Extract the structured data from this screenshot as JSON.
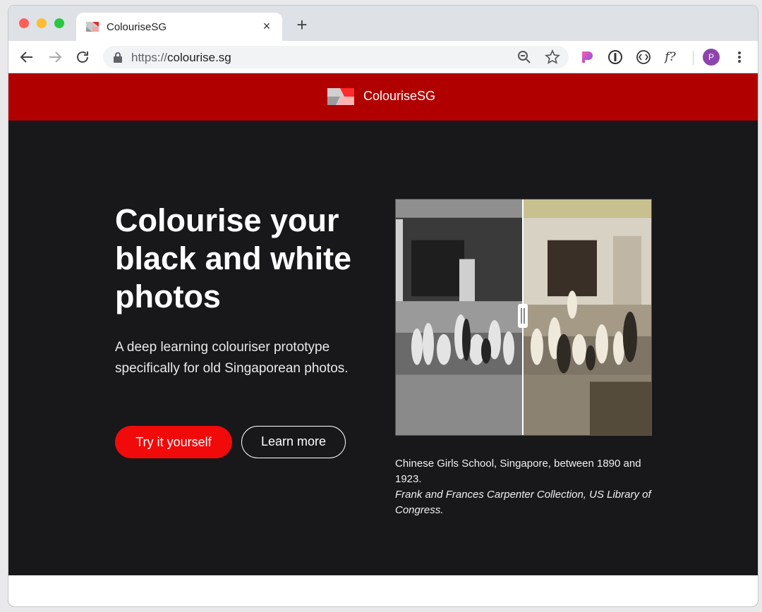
{
  "browser": {
    "tab_title": "ColouriseSG",
    "tab_close": "×",
    "new_tab": "+",
    "url_scheme": "https://",
    "url_host": "colourise.sg",
    "ext_f_label": "f?",
    "avatar_initial": "P",
    "avatar_color": "#8e44ad"
  },
  "site": {
    "brand_name": "ColouriseSG",
    "header_color": "#b10000",
    "background_color": "#18181b"
  },
  "hero": {
    "title": "Colourise your black and white photos",
    "subtitle": "A deep learning colouriser prototype specifically for old Singaporean photos.",
    "primary_button": "Try it yourself",
    "secondary_button": "Learn more",
    "accent_color": "#f00a0a"
  },
  "photo_comparison": {
    "caption": "Chinese Girls School, Singapore, between 1890 and 1923.",
    "credit": "Frank and Frances Carpenter Collection, US Library of Congress."
  }
}
